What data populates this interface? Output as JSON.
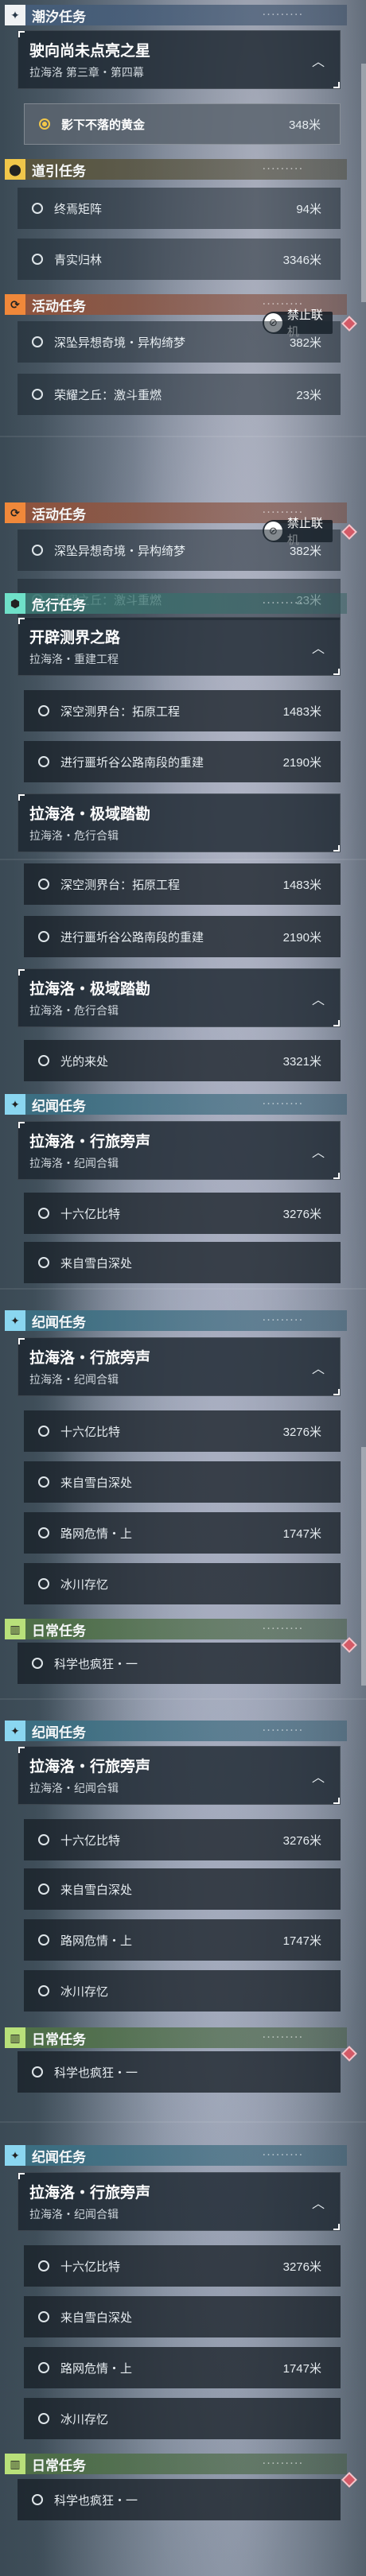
{
  "sections": {
    "chaoxi": "潮汐任务",
    "daoyin": "道引任务",
    "huodong": "活动任务",
    "weixing": "危行任务",
    "jiwen": "纪闻任务",
    "richang": "日常任务"
  },
  "badge": {
    "label": "禁止联机"
  },
  "quests": {
    "q1": {
      "title": "驶向尚未点亮之星",
      "subtitle": "拉海洛 第三章・第四幕"
    },
    "q2": {
      "title": "开辟测界之路",
      "subtitle": "拉海洛・重建工程"
    },
    "q3": {
      "title": "拉海洛・极域踏勘",
      "subtitle": "拉海洛・危行合辑"
    },
    "q4": {
      "title": "拉海洛・行旅旁声",
      "subtitle": "拉海洛・纪闻合辑"
    }
  },
  "items": {
    "gold": {
      "label": "影下不落的黄金",
      "dist": "348米"
    },
    "zhongmo": {
      "label": "终焉矩阵",
      "dist": "94米"
    },
    "qingshi": {
      "label": "青实归林",
      "dist": "3346米"
    },
    "shenkeng": {
      "label": "深坠异想奇境・异构绮梦",
      "dist": "382米"
    },
    "rongyao": {
      "label": "荣耀之丘：激斗重燃",
      "dist": "23米"
    },
    "shenkong": {
      "label": "深空测界台：拓原工程",
      "dist": "1483米"
    },
    "jinxing": {
      "label": "进行噩圻谷公路南段的重建",
      "dist": "2190米"
    },
    "guang": {
      "label": "光的来处",
      "dist": "3321米"
    },
    "shiliu": {
      "label": "十六亿比特",
      "dist": "3276米"
    },
    "xuebai": {
      "label": "来自雪白深处",
      "dist": ""
    },
    "luwang": {
      "label": "路网危情・上",
      "dist": "1747米"
    },
    "bingchuan": {
      "label": "冰川存忆",
      "dist": ""
    },
    "kexue": {
      "label": "科学也疯狂・一",
      "dist": ""
    }
  },
  "icons": {
    "chaoxi": "plus-star-icon",
    "daoyin": "location-pin-icon",
    "huodong": "refresh-arrows-icon",
    "weixing": "hexagon-icon",
    "jiwen": "plus-star-icon",
    "richang": "book-icon",
    "chevron": "chevron-up-icon",
    "no-coop": "no-coop-icon",
    "diamond": "diamond-marker-icon"
  }
}
